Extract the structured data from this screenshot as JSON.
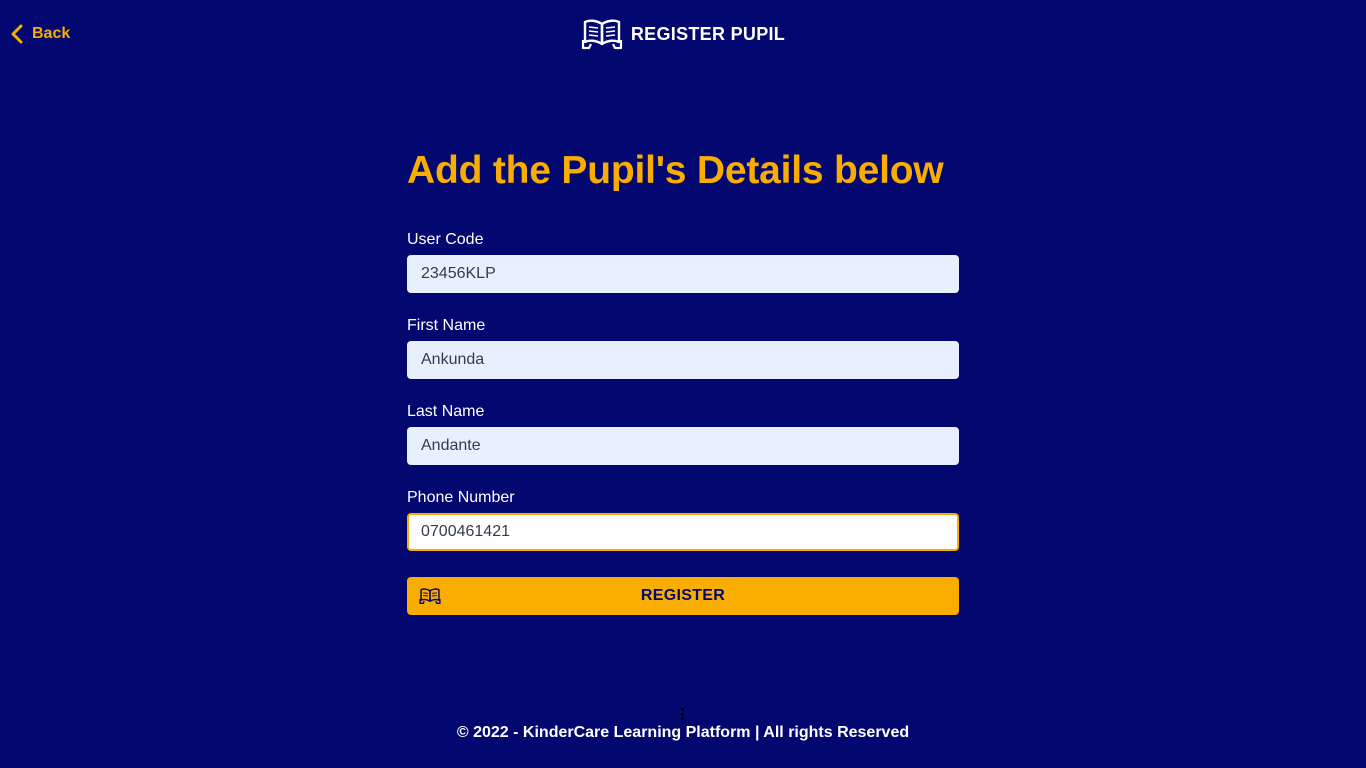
{
  "nav": {
    "back_label": "Back",
    "back_icon": "chevron-left-icon"
  },
  "header": {
    "title": "REGISTER PUPIL",
    "icon": "open-book-icon"
  },
  "form": {
    "heading": "Add the Pupil's Details below",
    "fields": [
      {
        "label": "User Code",
        "value": "23456KLP"
      },
      {
        "label": "First Name",
        "value": "Ankunda"
      },
      {
        "label": "Last Name",
        "value": "Andante"
      },
      {
        "label": "Phone Number",
        "value": "0700461421"
      }
    ],
    "submit": {
      "label": "REGISTER",
      "icon": "open-book-icon"
    }
  },
  "footer": {
    "text": "© 2022 - KinderCare Learning Platform | All rights Reserved"
  },
  "colors": {
    "background": "#020870",
    "accent": "#f9ad00",
    "input_background": "#e8f0fe",
    "text_light": "#ffffff"
  }
}
